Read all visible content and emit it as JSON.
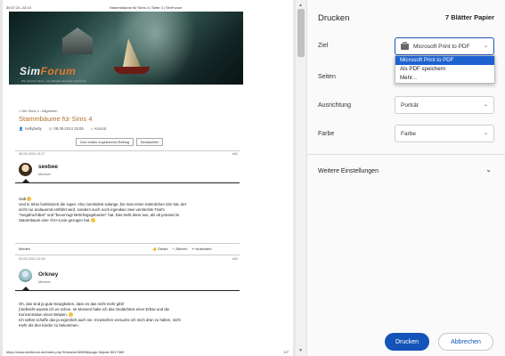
{
  "preview": {
    "header_left": "30.07.24, 22:24",
    "header_center": "Stammbäume für Sims 4 | Seite 3 | SimForum",
    "footer_left": "https://www.simforum.de/index.php?threads/155898/page-3#post-5017369",
    "footer_right": "1/7",
    "banner": {
      "logo_a": "Sim",
      "logo_b": "Forum",
      "sub": "Wir sprechen Sims – die offizielle deutsche Community"
    },
    "breadcrumb": "< Die Sims 4 : Allgemein",
    "thread_title": "Stammbäume für Sims 4",
    "meta": {
      "author": "Hollybetty",
      "date": "08.09.2014 15:05",
      "tag": "Konzol"
    },
    "buttons": [
      "Zum ersten ungelesenen Beitrag",
      "Beobachten"
    ],
    "posts": [
      {
        "date": "08.05.2024 19:27",
        "number": "#81",
        "name": "seebee",
        "role": "Member",
        "lines": [
          "Gab",
          "Und in Sims funktioniert die super. Also zumindest solange, bis man einen männlichen Sim hat, der",
          "nicht nur andauernd entführt wird, sondern auch noch irgendwo zwei versteckte Trait's",
          "\"megafruchtbar\" und \"bevorzugt Mehrlingsgeburten\" hat. Das sieht dann aus, als ob jemand im",
          "Stammbaum eine <hr>-Linie gezogen hat."
        ]
      },
      {
        "date": "20.05.2024 10:48",
        "number": "#83",
        "name": "Orkney",
        "role": "Member",
        "lines": [
          "Oh, das sind ja gute Neuigkeiten, dass es das nicht mehr gibt!",
          "(Vielleicht wusste ich es schon. Im Moment habe ich das Gedächtnis einer Erbse und die",
          "Konzentration eines Welpen.",
          "Ich selbst schaffe das ja eigentlich auch nie. Inzwischen versuche ich mich dran zu halten, nicht",
          "mehr als drei Kinder zu bekommen."
        ]
      }
    ],
    "post_actions": {
      "report": "Melden",
      "like": "Danke",
      "quote": "+ Zitieren",
      "reply": "Antworten"
    }
  },
  "panel": {
    "title": "Drucken",
    "page_count": "7 Blätter Papier",
    "labels": {
      "destination": "Ziel",
      "pages": "Seiten",
      "layout": "Ausrichtung",
      "color": "Farbe"
    },
    "destination_value": "Microsoft Print to PDF",
    "destination_options": [
      "Microsoft Print to PDF",
      "Als PDF speichern",
      "Mehr..."
    ],
    "layout_value": "Porträt",
    "color_value": "Farbe",
    "more_settings": "Weitere Einstellungen",
    "print_button": "Drucken",
    "cancel_button": "Abbrechen",
    "colors": {
      "accent": "#1454b8",
      "selected": "#1e62d0",
      "title": "#b16f2a"
    }
  }
}
